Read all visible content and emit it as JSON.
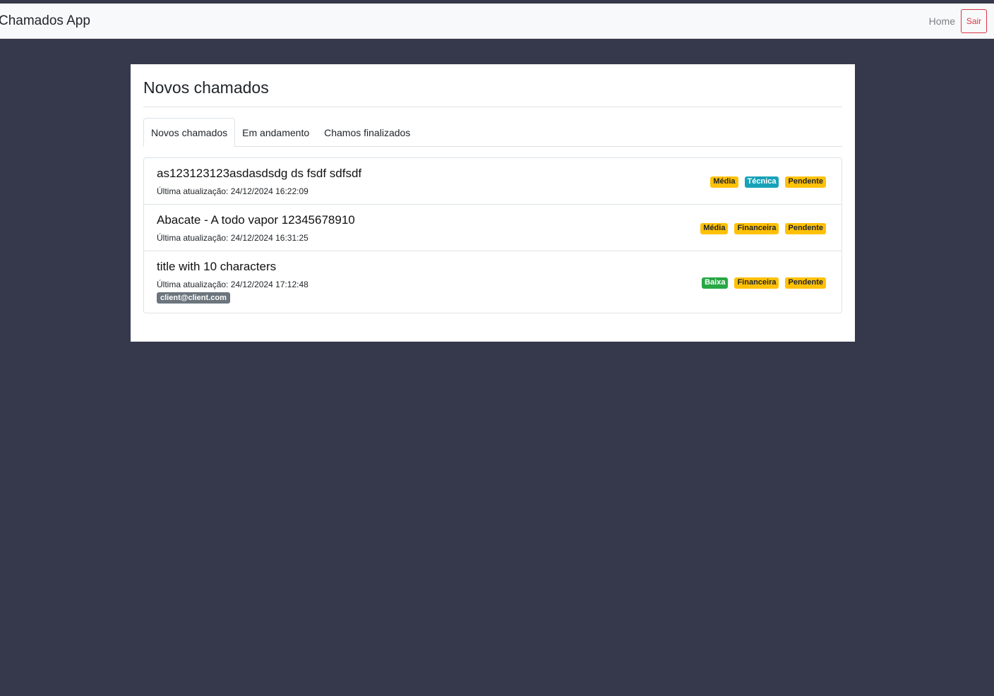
{
  "navbar": {
    "brand": "Chamados App",
    "home_label": "Home",
    "logout_label": "Sair"
  },
  "page": {
    "title": "Novos chamados",
    "tabs": [
      {
        "label": "Novos chamados",
        "active": true
      },
      {
        "label": "Em andamento",
        "active": false
      },
      {
        "label": "Chamos finalizados",
        "active": false
      }
    ]
  },
  "tickets": [
    {
      "title": "as123123123asdasdsdg ds fsdf sdfsdf",
      "updated": "Última atualização: 24/12/2024 16:22:09",
      "priority": "Média",
      "category": "Técnica",
      "status": "Pendente"
    },
    {
      "title": "Abacate - A todo vapor 12345678910",
      "updated": "Última atualização: 24/12/2024 16:31:25",
      "priority": "Média",
      "category": "Financeira",
      "status": "Pendente"
    },
    {
      "title": "title with 10 characters",
      "updated": "Última atualização: 24/12/2024 17:12:48",
      "email": "client@client.com",
      "priority": "Baixa",
      "category": "Financeira",
      "status": "Pendente"
    }
  ],
  "colors": {
    "background": "#36394b",
    "warning": "#ffc107",
    "info": "#17a2b8",
    "success": "#28a745",
    "secondary": "#6c757d",
    "danger": "#dc3545"
  }
}
